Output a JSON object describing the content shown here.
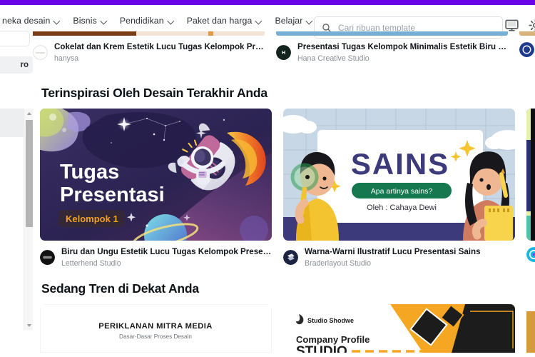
{
  "brand": {
    "accent_color": "#6b03e8"
  },
  "header": {
    "nav_items": [
      {
        "label": "neka desain",
        "icon": "chevron-down-icon"
      },
      {
        "label": "Bisnis",
        "icon": "chevron-down-icon"
      },
      {
        "label": "Pendidikan",
        "icon": "chevron-down-icon"
      },
      {
        "label": "Paket dan harga",
        "icon": "chevron-down-icon"
      },
      {
        "label": "Belajar",
        "icon": "chevron-down-icon"
      }
    ],
    "search": {
      "placeholder": "Cari ribuan template",
      "value": "",
      "icon": "search-icon"
    },
    "icons": [
      {
        "name": "monitor-icon"
      },
      {
        "name": "gear-icon"
      }
    ]
  },
  "left_rail": {
    "pro_label": "ro"
  },
  "sections": [
    {
      "heading": "Terinspirasi Oleh Desain Terakhir Anda",
      "cards": [
        {
          "title": "Biru dan Ungu Estetik Lucu Tugas Kelompok Presentasi",
          "author": "Letterhend Studio",
          "thumb": {
            "style": "space-astronaut",
            "headline_line1": "Tugas",
            "headline_line2": "Presentasi",
            "badge": "Kelompok 1",
            "bg_color": "#2b2352",
            "badge_color": "#f2a01e"
          }
        },
        {
          "title": "Warna-Warni Ilustratif Lucu Presentasi Sains",
          "author": "Braderlayout Studio",
          "thumb": {
            "style": "science-illustration",
            "headline": "SAINS",
            "pill": "Apa artinya sains?",
            "byline": "Oleh : Cahaya Dewi",
            "bg_color": "#c8d7e6",
            "pill_color": "#15784f",
            "headline_color": "#3d3a7c"
          }
        }
      ]
    },
    {
      "heading": "Sedang Tren di Dekat Anda",
      "cards": [
        {
          "thumb": {
            "style": "advertising-title",
            "headline": "PERIKLANAN MITRA MEDIA",
            "subhead": "Dasar-Dasar Proses Desain",
            "bg_color": "#ffffff"
          }
        },
        {
          "thumb": {
            "style": "company-profile",
            "brand": "Studio Shodwe",
            "headline": "Company Profile",
            "accent_color": "#f5a623",
            "bg_color": "#ffffff"
          }
        }
      ]
    }
  ],
  "top_row_cards": [
    {
      "title": "Cokelat dan Krem Estetik Lucu Tugas Kelompok Presentasi",
      "author": "hanysa",
      "avatar_label": "hanysa",
      "strip_color": "#f4e3d7"
    },
    {
      "title": "Presentasi Tugas Kelompok Minimalis Estetik Biru Langit da...",
      "author": "Hana Creative Studio",
      "avatar_label": "H",
      "strip_color": "#77aed4"
    }
  ]
}
